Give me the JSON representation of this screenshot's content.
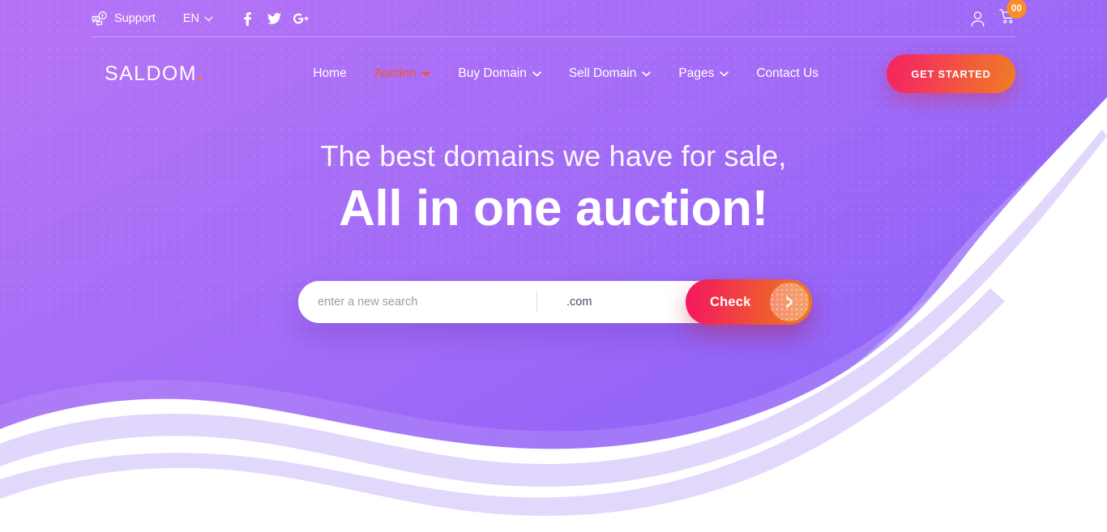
{
  "colors": {
    "purple_left": "#b06ef5",
    "purple_right": "#8f63f8",
    "accent_orange": "#f97b2e",
    "accent_pink": "#f4175e",
    "active_nav": "#f2562e",
    "badge": "#f78d2d",
    "white": "#ffffff"
  },
  "topbar": {
    "support_label": "Support",
    "support_icon": "chat-question-icon",
    "language": "EN",
    "language_chevron_icon": "chevron-down-icon",
    "socials": [
      {
        "name": "facebook",
        "icon": "facebook-icon",
        "glyph": "f"
      },
      {
        "name": "twitter",
        "icon": "twitter-icon",
        "glyph": "t"
      },
      {
        "name": "google-plus",
        "icon": "google-plus-icon",
        "glyph": "G+"
      }
    ],
    "account_icon": "user-icon",
    "cart_icon": "shopping-cart-icon",
    "cart_count": "00"
  },
  "navbar": {
    "logo_text": "SALDOM",
    "logo_dot": ".",
    "menu": [
      {
        "label": "Home",
        "has_dropdown": false,
        "active": false
      },
      {
        "label": "Auction",
        "has_dropdown": true,
        "active": true
      },
      {
        "label": "Buy Domain",
        "has_dropdown": true,
        "active": false
      },
      {
        "label": "Sell Domain",
        "has_dropdown": true,
        "active": false
      },
      {
        "label": "Pages",
        "has_dropdown": true,
        "active": false
      },
      {
        "label": "Contact Us",
        "has_dropdown": false,
        "active": false
      }
    ],
    "cta_label": "GET STARTED"
  },
  "hero": {
    "subtitle": "The best domains we have for sale,",
    "title": "All in one auction!"
  },
  "search": {
    "placeholder": "enter a new search",
    "value": "",
    "tld_selected": ".com",
    "tld_chevron_icon": "chevron-down-icon",
    "submit_label": "Check",
    "submit_arrow_icon": "chevron-right-icon"
  }
}
